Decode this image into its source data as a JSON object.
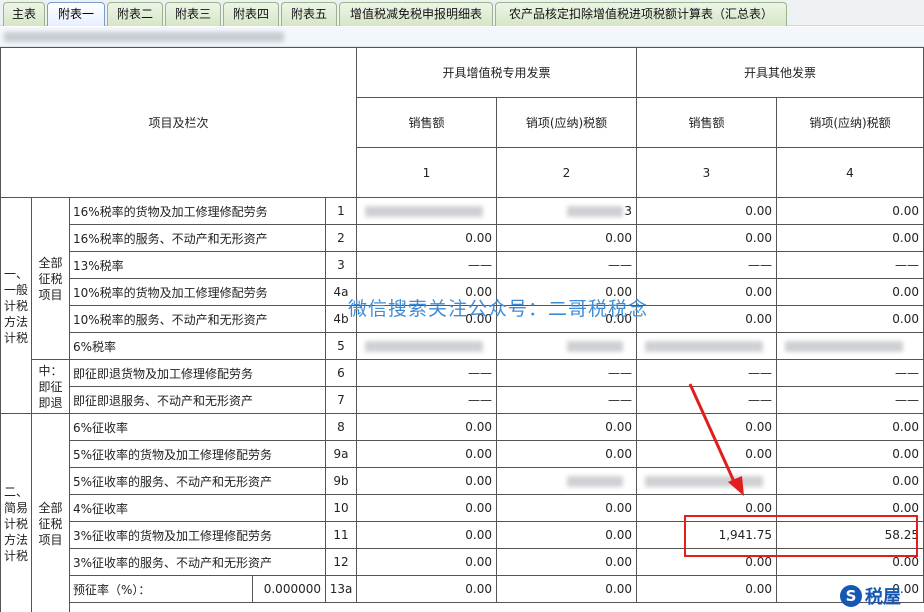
{
  "tabs": [
    {
      "label": "主表"
    },
    {
      "label": "附表一"
    },
    {
      "label": "附表二"
    },
    {
      "label": "附表三"
    },
    {
      "label": "附表四"
    },
    {
      "label": "附表五"
    },
    {
      "label": "增值税减免税申报明细表"
    },
    {
      "label": "农产品核定扣除增值税进项税额计算表（汇总表）"
    }
  ],
  "active_tab": "附表一",
  "header": {
    "project": "项目及栏次",
    "group_special": "开具增值税专用发票",
    "group_other": "开具其他发票",
    "sales": "销售额",
    "tax": "销项(应纳)税额",
    "col_nums": [
      "1",
      "2",
      "3",
      "4"
    ]
  },
  "sections": {
    "general_method": "一、一般计税方法计税",
    "simple_method": "二、简易计税方法计税",
    "all_items": "全部征税项目",
    "refund_items": "其中：即征即退项目"
  },
  "rows": [
    {
      "name": "16%税率的货物及加工修理修配劳务",
      "num": "1",
      "v1": "",
      "v2": "3",
      "v3": "0.00",
      "v4": "0.00"
    },
    {
      "name": "16%税率的服务、不动产和无形资产",
      "num": "2",
      "v1": "0.00",
      "v2": "0.00",
      "v3": "0.00",
      "v4": "0.00"
    },
    {
      "name": "13%税率",
      "num": "3",
      "v1": "——",
      "v2": "——",
      "v3": "——",
      "v4": "——"
    },
    {
      "name": "10%税率的货物及加工修理修配劳务",
      "num": "4a",
      "v1": "0.00",
      "v2": "0.00",
      "v3": "0.00",
      "v4": "0.00"
    },
    {
      "name": "10%税率的服务、不动产和无形资产",
      "num": "4b",
      "v1": "0.00",
      "v2": "0.00",
      "v3": "0.00",
      "v4": "0.00"
    },
    {
      "name": "6%税率",
      "num": "5",
      "v1": "",
      "v2": "",
      "v3": "",
      "v4": ""
    },
    {
      "name": "即征即退货物及加工修理修配劳务",
      "num": "6",
      "v1": "——",
      "v2": "——",
      "v3": "——",
      "v4": "——"
    },
    {
      "name": "即征即退服务、不动产和无形资产",
      "num": "7",
      "v1": "——",
      "v2": "——",
      "v3": "——",
      "v4": "——"
    },
    {
      "name": "6%征收率",
      "num": "8",
      "v1": "0.00",
      "v2": "0.00",
      "v3": "0.00",
      "v4": "0.00"
    },
    {
      "name": "5%征收率的货物及加工修理修配劳务",
      "num": "9a",
      "v1": "0.00",
      "v2": "0.00",
      "v3": "0.00",
      "v4": "0.00"
    },
    {
      "name": "5%征收率的服务、不动产和无形资产",
      "num": "9b",
      "v1": "0.00",
      "v2": "",
      "v3": "",
      "v4": "0.00"
    },
    {
      "name": "4%征收率",
      "num": "10",
      "v1": "0.00",
      "v2": "0.00",
      "v3": "0.00",
      "v4": "0.00"
    },
    {
      "name": "3%征收率的货物及加工修理修配劳务",
      "num": "11",
      "v1": "0.00",
      "v2": "0.00",
      "v3": "1,941.75",
      "v4": "58.25"
    },
    {
      "name": "3%征收率的服务、不动产和无形资产",
      "num": "12",
      "v1": "0.00",
      "v2": "0.00",
      "v3": "0.00",
      "v4": "0.00"
    },
    {
      "name": "预征率（%）：",
      "rate": "0.000000",
      "num": "13a",
      "v1": "0.00",
      "v2": "0.00",
      "v3": "0.00",
      "v4": "0.00"
    }
  ],
  "watermark": "微信搜索关注公众号：二哥税税念",
  "logo": "税屋",
  "colors": {
    "highlight": "#e11d1d",
    "watermark": "#3f8cd6",
    "logo": "#1557b5"
  }
}
